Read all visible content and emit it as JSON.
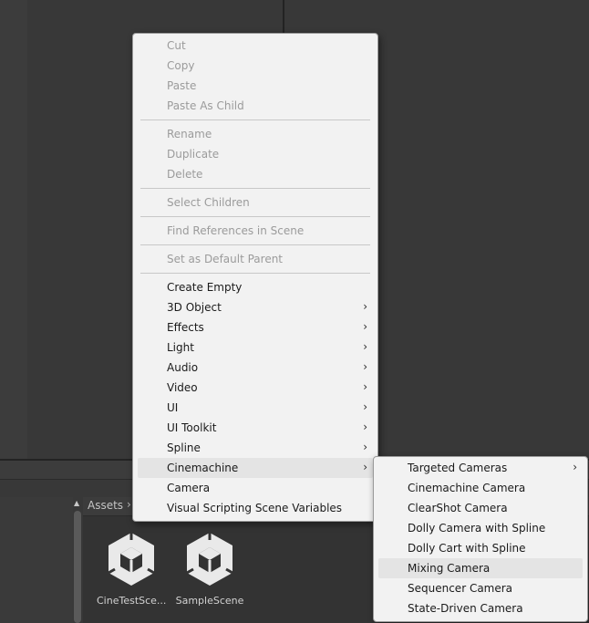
{
  "context_menu": {
    "edit": [
      "Cut",
      "Copy",
      "Paste",
      "Paste As Child"
    ],
    "rename": [
      "Rename",
      "Duplicate",
      "Delete"
    ],
    "select_children": "Select Children",
    "find_refs": "Find References in Scene",
    "set_default_parent": "Set as Default Parent",
    "create": [
      {
        "label": "Create Empty"
      },
      {
        "label": "3D Object",
        "submenu": true
      },
      {
        "label": "Effects",
        "submenu": true
      },
      {
        "label": "Light",
        "submenu": true
      },
      {
        "label": "Audio",
        "submenu": true
      },
      {
        "label": "Video",
        "submenu": true
      },
      {
        "label": "UI",
        "submenu": true
      },
      {
        "label": "UI Toolkit",
        "submenu": true
      },
      {
        "label": "Spline",
        "submenu": true
      },
      {
        "label": "Cinemachine",
        "submenu": true,
        "highlighted": true
      },
      {
        "label": "Camera"
      },
      {
        "label": "Visual Scripting Scene Variables"
      }
    ],
    "arrow_glyph": "›"
  },
  "cinemachine_submenu": [
    {
      "label": "Targeted Cameras",
      "submenu": true
    },
    {
      "label": "Cinemachine Camera"
    },
    {
      "label": "ClearShot Camera"
    },
    {
      "label": "Dolly Camera with Spline"
    },
    {
      "label": "Dolly Cart with Spline"
    },
    {
      "label": "Mixing Camera",
      "highlighted": true
    },
    {
      "label": "Sequencer Camera"
    },
    {
      "label": "State-Driven Camera"
    }
  ],
  "project": {
    "breadcrumb": "Assets",
    "breadcrumb_chevron": "›",
    "assets": [
      {
        "name": "CineTestSce...",
        "icon": "unity-scene-icon"
      },
      {
        "name": "SampleScene",
        "icon": "unity-scene-icon"
      }
    ]
  },
  "colors": {
    "menu_bg": "#f2f2f2",
    "highlight": "#e4e4e4",
    "disabled_text": "#9b9b9b",
    "editor_bg": "#383838"
  }
}
